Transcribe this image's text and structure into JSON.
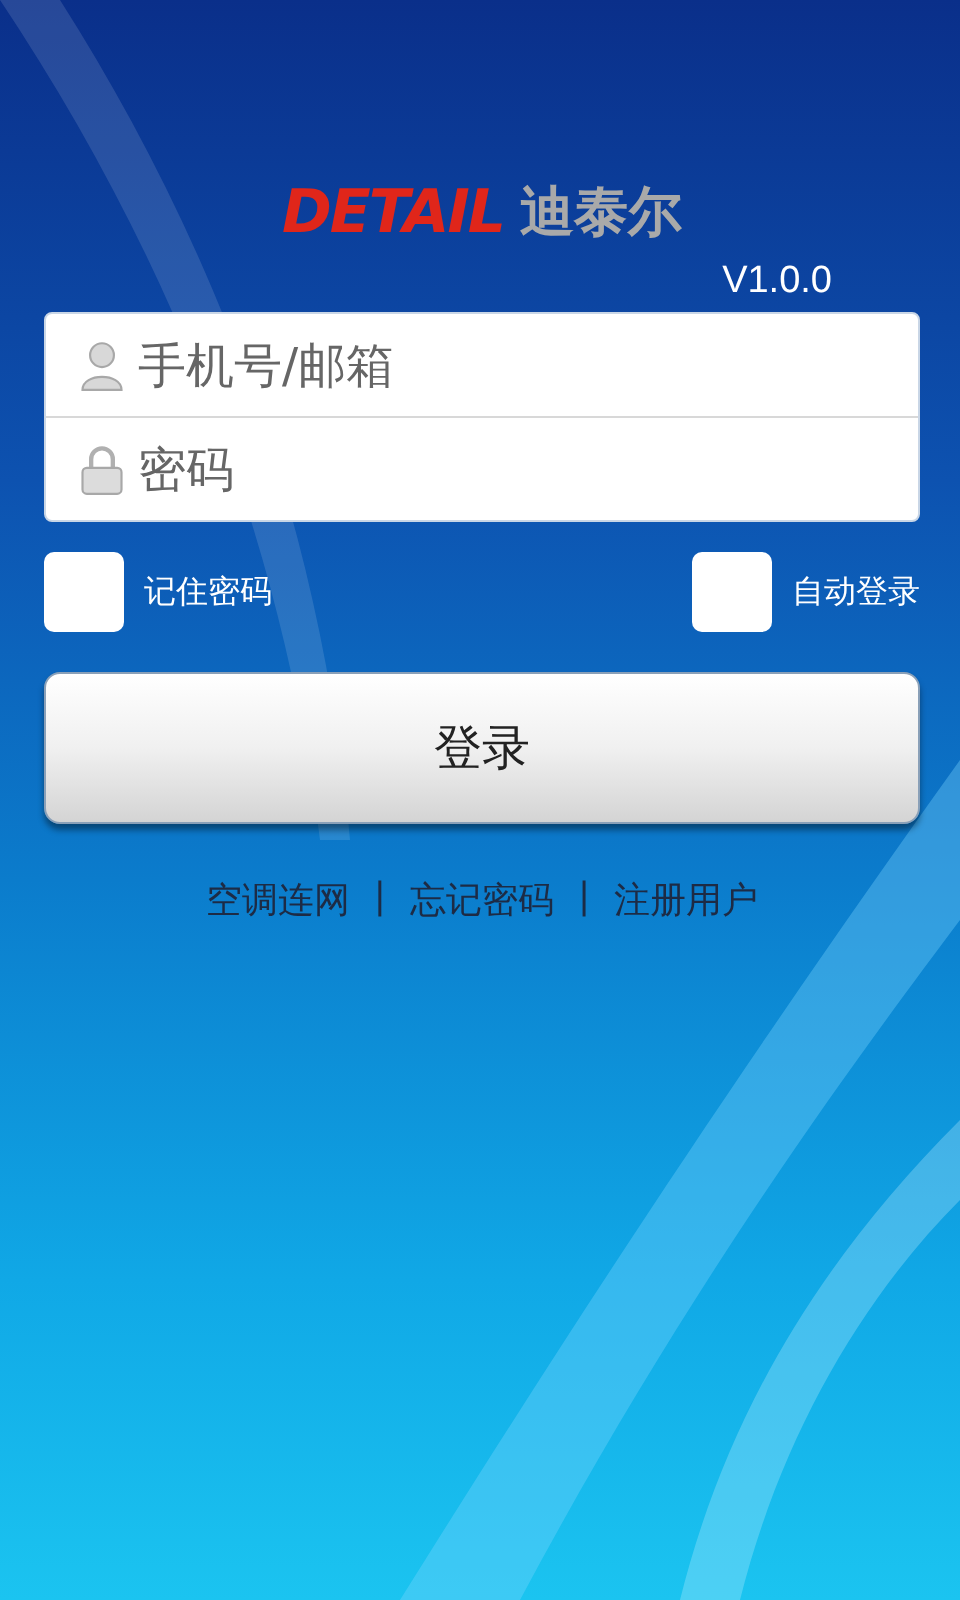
{
  "logo": {
    "brand": "DETAIL",
    "brand_cn": "迪泰尔"
  },
  "version": "V1.0.0",
  "fields": [
    {
      "kind": "user",
      "placeholder": "手机号/邮箱"
    },
    {
      "kind": "lock",
      "placeholder": "密码"
    }
  ],
  "options": [
    {
      "label": "记住密码",
      "checked": false
    },
    {
      "label": "自动登录",
      "checked": false
    }
  ],
  "login_button": "登录",
  "links": [
    "空调连网",
    "忘记密码",
    "注册用户"
  ],
  "link_separators": [
    "|",
    "|"
  ]
}
